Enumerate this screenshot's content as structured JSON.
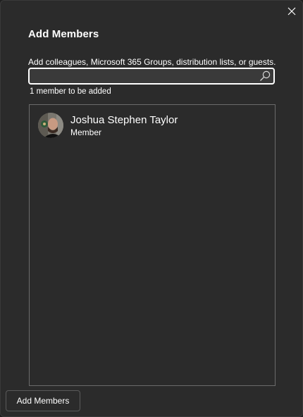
{
  "dialog": {
    "title": "Add Members",
    "close_icon": "close-icon"
  },
  "search": {
    "label": "Add colleagues, Microsoft 365 Groups, distribution lists, or guests.",
    "value": "",
    "placeholder": "",
    "icon": "search-icon"
  },
  "summary": {
    "count_text": "1 member to be added"
  },
  "members": [
    {
      "name": "Joshua Stephen Taylor",
      "role": "Member",
      "avatar_icon": "avatar"
    }
  ],
  "footer": {
    "add_button_label": "Add Members"
  },
  "colors": {
    "background": "#2b2b2b",
    "border": "#6b6b6b",
    "text": "#ffffff"
  }
}
